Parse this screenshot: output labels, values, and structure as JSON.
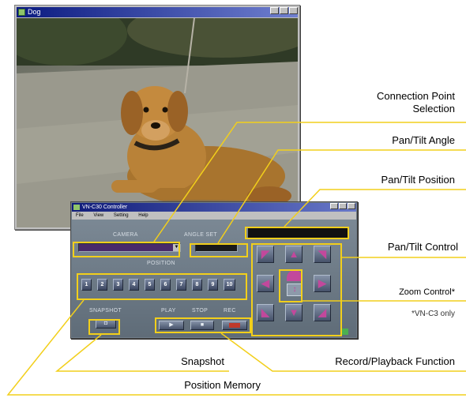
{
  "viewer": {
    "title": "Dog"
  },
  "controller": {
    "title": "VN-C30 Controller",
    "menu": [
      "File",
      "View",
      "Setting",
      "Help"
    ],
    "camera_label": "CAMERA",
    "angle_set_label": "ANGLE SET",
    "position_label": "POSITION",
    "position_buttons": [
      "1",
      "2",
      "3",
      "4",
      "5",
      "6",
      "7",
      "8",
      "9",
      "10"
    ],
    "snapshot_label": "SNAPSHOT",
    "play_label": "PLAY",
    "stop_label": "STOP",
    "rec_label": "REC",
    "play_symbol": "▶",
    "stop_symbol": "■",
    "arrows": {
      "up_left": "◤",
      "up": "▲",
      "up_right": "◥",
      "left": "◀",
      "right": "▶",
      "down_left": "◣",
      "down": "▼",
      "down_right": "◢"
    }
  },
  "callouts": {
    "connection_point": "Connection Point\nSelection",
    "pan_tilt_angle": "Pan/Tilt Angle",
    "pan_tilt_position": "Pan/Tilt Position",
    "pan_tilt_control": "Pan/Tilt Control",
    "zoom_control": "Zoom Control*",
    "zoom_note": "*VN-C3 only",
    "snapshot": "Snapshot",
    "record_playback": "Record/Playback Function",
    "position_memory": "Position Memory"
  },
  "colors": {
    "callout_line": "#f2cf1b",
    "arrow_accent": "#c2489c"
  }
}
